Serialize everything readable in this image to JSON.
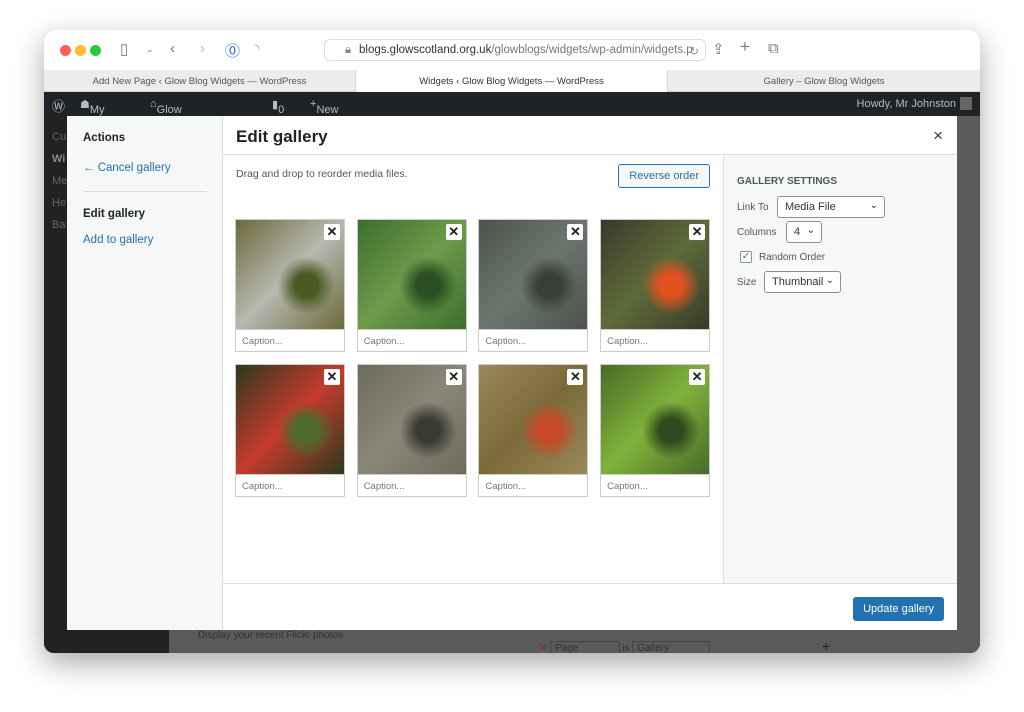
{
  "browser": {
    "url_domain": "blogs.glowscotland.org.uk",
    "url_path": "/glowblogs/widgets/wp-admin/widgets.p",
    "tabs": [
      {
        "label": "Add New Page ‹ Glow Blog Widgets — WordPress"
      },
      {
        "label": "Widgets ‹ Glow Blog Widgets — WordPress",
        "active": true
      },
      {
        "label": "Gallery – Glow Blog Widgets"
      }
    ]
  },
  "adminbar": {
    "my_sites": "My Sites",
    "site": "Glow Blog Widgets",
    "comments": "0",
    "new": "New",
    "howdy": "Howdy, Mr Johnston"
  },
  "background": {
    "menu": [
      "Cu",
      "Wi",
      "Me",
      "He",
      "Ba"
    ],
    "flickr_text": "Display your recent Flickr photos.",
    "rule_select1": "Page",
    "rule_is": "is",
    "rule_select2": "Gallery"
  },
  "modal": {
    "sidebar": {
      "actions_heading": "Actions",
      "cancel": "← Cancel gallery",
      "edit_heading": "Edit gallery",
      "add": "Add to gallery"
    },
    "title": "Edit gallery",
    "close": "×",
    "instructions": "Drag and drop to reorder media files.",
    "reverse_order": "Reverse order",
    "caption_placeholder": "Caption...",
    "images": [
      {
        "colors": [
          "#6b6a3a",
          "#b8b8b0",
          "#4a5a22"
        ]
      },
      {
        "colors": [
          "#3d6e2e",
          "#6d9b4a",
          "#2b4f22"
        ]
      },
      {
        "colors": [
          "#4b534c",
          "#6d766e",
          "#39403a"
        ]
      },
      {
        "colors": [
          "#3a3a2a",
          "#5e6b3a",
          "#e0521f"
        ]
      },
      {
        "colors": [
          "#2b3a1e",
          "#c63b2d",
          "#4f6b2b"
        ]
      },
      {
        "colors": [
          "#6d6a5e",
          "#8a867a",
          "#3a3a33"
        ]
      },
      {
        "colors": [
          "#9a8a5a",
          "#7a6a3a",
          "#c84a2a"
        ]
      },
      {
        "colors": [
          "#4a6a2a",
          "#7fb23a",
          "#2f4a1e"
        ]
      }
    ],
    "settings": {
      "heading": "GALLERY SETTINGS",
      "link_to_label": "Link To",
      "link_to": "Media File",
      "columns_label": "Columns",
      "columns": "4",
      "random_label": "Random Order",
      "random_checked": true,
      "size_label": "Size",
      "size": "Thumbnail"
    },
    "update": "Update gallery"
  },
  "colors": {
    "accent": "#2271b1",
    "adminbar": "#1d2327"
  }
}
